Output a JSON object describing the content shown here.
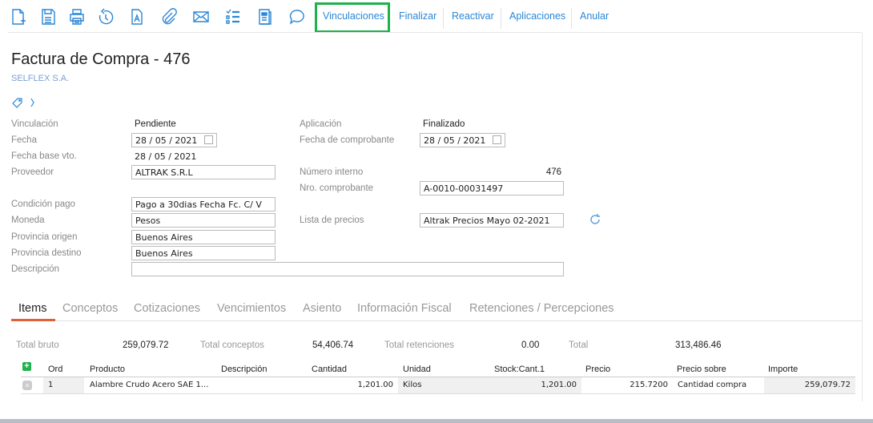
{
  "toolbar": {
    "icons": [
      "new-document-icon",
      "save-icon",
      "print-icon",
      "history-icon",
      "text-document-icon",
      "attachment-icon",
      "email-icon",
      "checklist-icon",
      "report-icon",
      "comment-icon"
    ],
    "buttons": [
      "Vinculaciones",
      "Finalizar",
      "Reactivar",
      "Aplicaciones",
      "Anular"
    ],
    "highlight_color": "#1db24a"
  },
  "header": {
    "title": "Factura de Compra - 476",
    "company": "SELFLEX S.A."
  },
  "form": {
    "vinculacion": {
      "label": "Vinculación",
      "value": "Pendiente"
    },
    "fecha": {
      "label": "Fecha",
      "value": "28 / 05 / 2021"
    },
    "fecha_base": {
      "label": "Fecha base vto.",
      "value": "28 / 05 / 2021"
    },
    "proveedor": {
      "label": "Proveedor",
      "value": "ALTRAK S.R.L"
    },
    "condicion": {
      "label": "Condición pago",
      "value": "Pago a 30dias Fecha Fc. C/ V"
    },
    "moneda": {
      "label": "Moneda",
      "value": "Pesos"
    },
    "prov_origen": {
      "label": "Provincia origen",
      "value": "Buenos Aires"
    },
    "prov_destino": {
      "label": "Provincia destino",
      "value": "Buenos Aires"
    },
    "descripcion": {
      "label": "Descripción",
      "value": ""
    },
    "aplicacion": {
      "label": "Aplicación",
      "value": "Finalizado"
    },
    "fecha_comp": {
      "label": "Fecha de comprobante",
      "value": "28 / 05 / 2021"
    },
    "num_interno": {
      "label": "Número interno",
      "value": "476"
    },
    "nro_comp": {
      "label": "Nro. comprobante",
      "value": "A-0010-00031497"
    },
    "lista": {
      "label": "Lista de precios",
      "value": "Altrak Precios Mayo 02-2021"
    }
  },
  "tabs": [
    "Items",
    "Conceptos",
    "Cotizaciones",
    "Vencimientos",
    "Asiento",
    "Información Fiscal",
    "Retenciones / Percepciones"
  ],
  "totals": {
    "bruto": {
      "label": "Total bruto",
      "value": "259,079.72"
    },
    "conceptos": {
      "label": "Total conceptos",
      "value": "54,406.74"
    },
    "retenciones": {
      "label": "Total retenciones",
      "value": "0.00"
    },
    "total": {
      "label": "Total",
      "value": "313,486.46"
    }
  },
  "table": {
    "headers": [
      "Ord",
      "Producto",
      "Descripción",
      "Cantidad",
      "Unidad",
      "Stock:Cant.1",
      "Precio",
      "Precio sobre",
      "Importe"
    ],
    "rows": [
      {
        "ord": "1",
        "producto": "Alambre Crudo Acero SAE 1...",
        "descripcion": "",
        "cantidad": "1,201.00",
        "unidad": "Kilos",
        "stock": "1,201.00",
        "precio": "215.7200",
        "precio_sobre": "Cantidad compra",
        "importe": "259,079.72"
      }
    ]
  }
}
